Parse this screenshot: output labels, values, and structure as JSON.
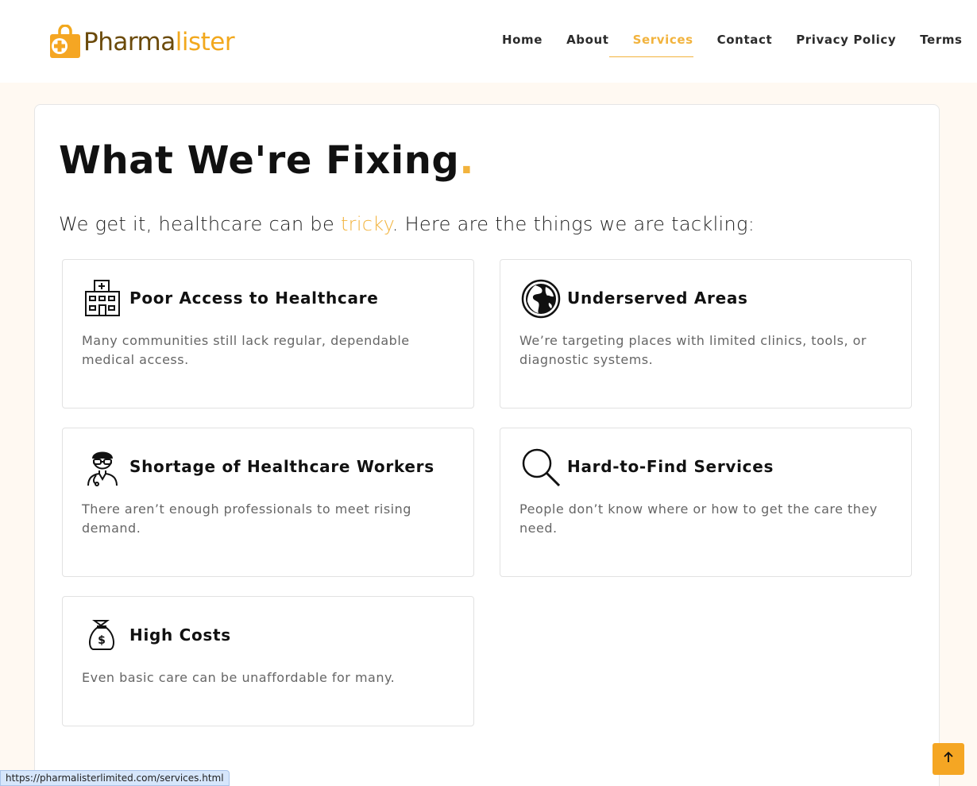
{
  "brand": {
    "name_part1": "Pharma",
    "name_part2": "lister",
    "accent_color": "#f2a81d"
  },
  "nav": {
    "items": [
      {
        "label": "Home",
        "active": false
      },
      {
        "label": "About",
        "active": false
      },
      {
        "label": "Services",
        "active": true
      },
      {
        "label": "Contact",
        "active": false
      },
      {
        "label": "Privacy Policy",
        "active": false
      },
      {
        "label": "Terms",
        "active": false
      }
    ]
  },
  "section": {
    "title": "What We're Fixing",
    "title_dot": ".",
    "subtitle_before": "We get it, healthcare can be ",
    "subtitle_highlight": "tricky",
    "subtitle_after": ". Here are the things we are tackling:"
  },
  "features": [
    {
      "icon": "hospital-icon",
      "title": "Poor Access to Healthcare",
      "text": "Many communities still lack regular, dependable medical access."
    },
    {
      "icon": "globe-icon",
      "title": "Underserved Areas",
      "text": "We’re targeting places with limited clinics, tools, or diagnostic systems."
    },
    {
      "icon": "doctor-icon",
      "title": "Shortage of Healthcare Workers",
      "text": "There aren’t enough professionals to meet rising demand."
    },
    {
      "icon": "magnifier-icon",
      "title": "Hard-to-Find Services",
      "text": "People don’t know where or how to get the care they need."
    },
    {
      "icon": "money-bag-icon",
      "title": "High Costs",
      "text": "Even basic care can be unaffordable for many."
    }
  ],
  "status_url": "https://pharmalisterlimited.com/services.html",
  "back_to_top": {
    "icon": "arrow-up-icon",
    "color": "#f5a623"
  }
}
